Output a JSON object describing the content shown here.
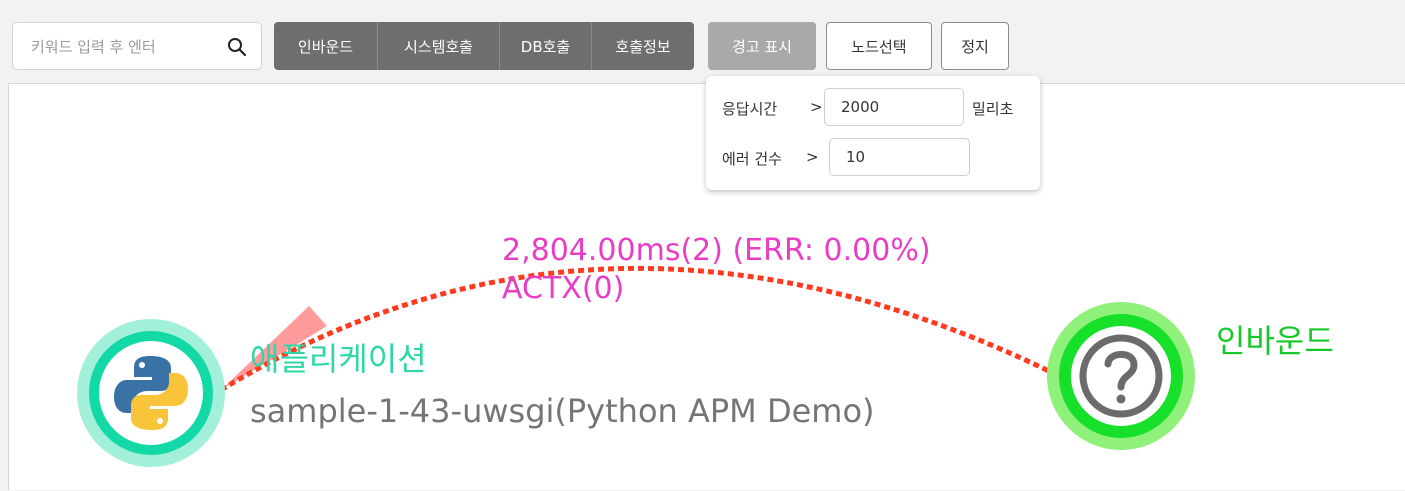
{
  "search": {
    "placeholder": "키워드 입력 후 엔터",
    "value": ""
  },
  "toolbar": {
    "segments": [
      "인바운드",
      "시스템호출",
      "DB호출",
      "호출정보"
    ],
    "warning_label": "경고 표시",
    "node_select_label": "노드선택",
    "stop_label": "정지"
  },
  "warning_popup": {
    "response_label": "응답시간",
    "response_op": ">",
    "response_value": "2000",
    "response_unit": "밀리초",
    "error_label": "에러 건수",
    "error_op": ">",
    "error_value": "10"
  },
  "edge": {
    "line1": "2,804.00ms(2) (ERR: 0.00%)",
    "line2": "ACTX(0)",
    "color": "#ff3b1f"
  },
  "app_node": {
    "title": "애플리케이션",
    "subtitle": "sample-1-43-uwsgi(Python APM Demo)",
    "icon": "python-icon",
    "ring_color": "#12d9a5"
  },
  "inbound_node": {
    "title": "인바운드",
    "icon": "question-mark-icon",
    "ring_color": "#16e02a"
  }
}
